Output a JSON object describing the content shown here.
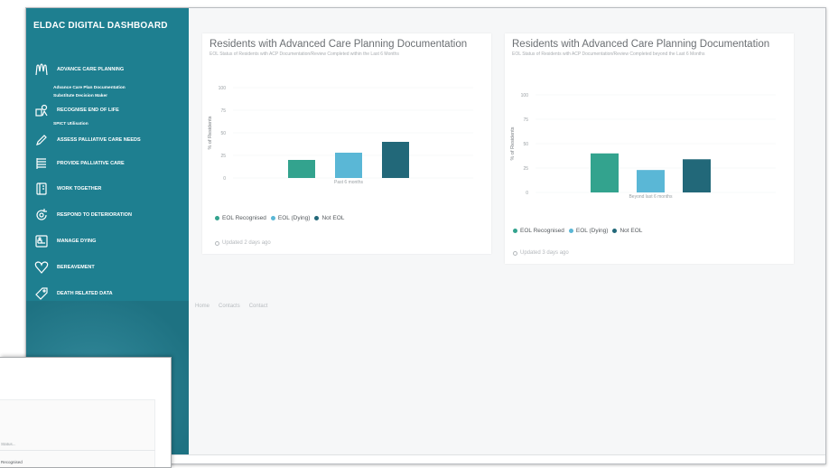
{
  "sidebar": {
    "title": "ELDAC DIGITAL DASHBOARD",
    "items": [
      {
        "label": "ADVANCE CARE PLANNING",
        "icon": "hands-icon",
        "subs": [
          "Advance Care Plan Documentation",
          "Substitute Decision Maker"
        ]
      },
      {
        "label": "RECOGNISE END OF LIFE",
        "icon": "recognise-icon",
        "subs": [
          "SPICT Utilisation"
        ]
      },
      {
        "label": "ASSESS PALLIATIVE CARE NEEDS",
        "icon": "pen-icon",
        "subs": []
      },
      {
        "label": "PROVIDE PALLIATIVE CARE",
        "icon": "list-icon",
        "subs": []
      },
      {
        "label": "WORK TOGETHER",
        "icon": "book-icon",
        "subs": []
      },
      {
        "label": "RESPOND TO DETERIORATION",
        "icon": "refresh-icon",
        "subs": []
      },
      {
        "label": "MANAGE DYING",
        "icon": "bed-icon",
        "subs": []
      },
      {
        "label": "BEREAVEMENT",
        "icon": "heart-icon",
        "subs": []
      },
      {
        "label": "DEATH RELATED DATA",
        "icon": "tag-icon",
        "subs": []
      }
    ]
  },
  "cards": [
    {
      "title": "Residents with Advanced Care Planning Documentation",
      "subtitle": "EOL Status of Residents with ACP Documentation/Review Completed within the Last 6 Months",
      "updated": "Updated 2 days ago"
    },
    {
      "title": "Residents with Advanced Care Planning Documentation",
      "subtitle": "EOL Status of Residents with ACP Documentation/Review Completed beyond the Last 6 Months",
      "updated": "Updated 3 days ago"
    }
  ],
  "chart_data": [
    {
      "type": "bar",
      "ylabel": "% of Residents",
      "ylim": [
        0,
        100
      ],
      "ticks": [
        "100",
        "75",
        "50",
        "25",
        "0"
      ],
      "categories": [
        "Past 6 months"
      ],
      "series": [
        {
          "name": "EOL Recognised",
          "values": [
            20
          ],
          "color": "#33a38e"
        },
        {
          "name": "EOL (Dying)",
          "values": [
            28
          ],
          "color": "#5ab7d6"
        },
        {
          "name": "Not EOL",
          "values": [
            40
          ],
          "color": "#226879"
        }
      ],
      "legend": "bottom-left"
    },
    {
      "type": "bar",
      "ylabel": "% of Residents",
      "ylim": [
        0,
        100
      ],
      "ticks": [
        "100",
        "75",
        "50",
        "25",
        "0"
      ],
      "categories": [
        "Beyond last 6 months"
      ],
      "series": [
        {
          "name": "EOL Recognised",
          "values": [
            40
          ],
          "color": "#33a38e"
        },
        {
          "name": "EOL (Dying)",
          "values": [
            23
          ],
          "color": "#5ab7d6"
        },
        {
          "name": "Not EOL",
          "values": [
            34
          ],
          "color": "#226879"
        }
      ],
      "legend": "bottom-left"
    }
  ],
  "footer": {
    "links": [
      "Home",
      "Contacts",
      "Contact"
    ]
  },
  "overlay": {
    "line1": "Status...",
    "line2": "Recognised"
  }
}
